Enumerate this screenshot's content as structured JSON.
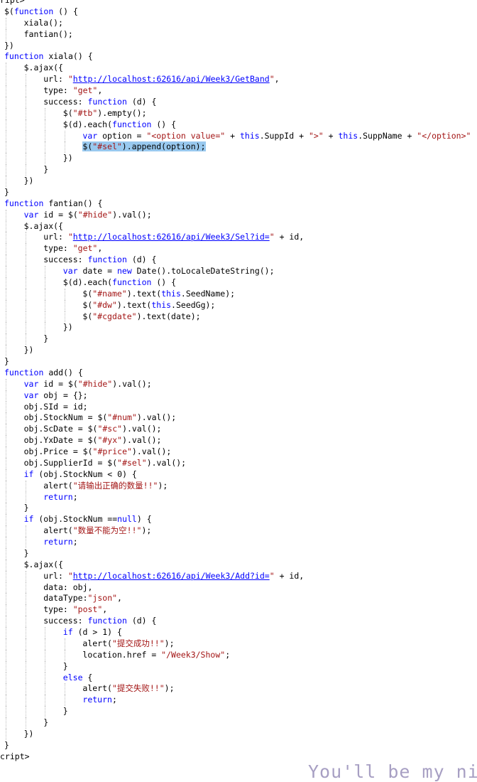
{
  "code": {
    "lines": [
      {
        "indent": 0,
        "tokens": [
          {
            "t": "ript>"
          }
        ]
      },
      {
        "indent": 0,
        "tokens": [
          {
            "t": "$("
          },
          {
            "t": "function",
            "c": "kw"
          },
          {
            "t": " () {"
          }
        ]
      },
      {
        "indent": 1,
        "tokens": [
          {
            "t": "xiala();"
          }
        ]
      },
      {
        "indent": 1,
        "tokens": [
          {
            "t": "fantian();"
          }
        ]
      },
      {
        "indent": 0,
        "tokens": [
          {
            "t": "})"
          }
        ]
      },
      {
        "indent": 0,
        "tokens": [
          {
            "t": "function",
            "c": "kw"
          },
          {
            "t": " xiala() {"
          }
        ]
      },
      {
        "indent": 1,
        "tokens": [
          {
            "t": "$.ajax({"
          }
        ]
      },
      {
        "indent": 2,
        "tokens": [
          {
            "t": "url: "
          },
          {
            "t": "\"",
            "c": "str"
          },
          {
            "t": "http://localhost:62616/api/Week3/GetBand",
            "c": "url"
          },
          {
            "t": "\"",
            "c": "str"
          },
          {
            "t": ","
          }
        ]
      },
      {
        "indent": 2,
        "tokens": [
          {
            "t": "type: "
          },
          {
            "t": "\"get\"",
            "c": "str"
          },
          {
            "t": ","
          }
        ]
      },
      {
        "indent": 2,
        "tokens": [
          {
            "t": "success: "
          },
          {
            "t": "function",
            "c": "kw"
          },
          {
            "t": " (d) {"
          }
        ]
      },
      {
        "indent": 3,
        "tokens": [
          {
            "t": "$("
          },
          {
            "t": "\"#tb\"",
            "c": "str"
          },
          {
            "t": ").empty();"
          }
        ]
      },
      {
        "indent": 3,
        "tokens": [
          {
            "t": "$(d).each("
          },
          {
            "t": "function",
            "c": "kw"
          },
          {
            "t": " () {"
          }
        ]
      },
      {
        "indent": 4,
        "tokens": [
          {
            "t": "var",
            "c": "kw"
          },
          {
            "t": " option = "
          },
          {
            "t": "\"<option value=\"",
            "c": "str"
          },
          {
            "t": " + "
          },
          {
            "t": "this",
            "c": "kw"
          },
          {
            "t": ".SuppId + "
          },
          {
            "t": "\">\"",
            "c": "str"
          },
          {
            "t": " + "
          },
          {
            "t": "this",
            "c": "kw"
          },
          {
            "t": ".SuppName + "
          },
          {
            "t": "\"</option>\"",
            "c": "str"
          }
        ]
      },
      {
        "indent": 4,
        "tokens": [
          {
            "t": "$(",
            "c": "hl"
          },
          {
            "t": "\"#sel\"",
            "c": "hl-str"
          },
          {
            "t": ").append(option);",
            "c": "hl"
          }
        ]
      },
      {
        "indent": 3,
        "tokens": [
          {
            "t": "})"
          }
        ]
      },
      {
        "indent": 2,
        "tokens": [
          {
            "t": "}"
          }
        ]
      },
      {
        "indent": 1,
        "tokens": [
          {
            "t": "})"
          }
        ]
      },
      {
        "indent": 0,
        "tokens": [
          {
            "t": "}"
          }
        ]
      },
      {
        "indent": 0,
        "tokens": [
          {
            "t": "function",
            "c": "kw"
          },
          {
            "t": " fantian() {"
          }
        ]
      },
      {
        "indent": 1,
        "tokens": [
          {
            "t": "var",
            "c": "kw"
          },
          {
            "t": " id = $("
          },
          {
            "t": "\"#hide\"",
            "c": "str"
          },
          {
            "t": ").val();"
          }
        ]
      },
      {
        "indent": 1,
        "tokens": [
          {
            "t": "$.ajax({"
          }
        ]
      },
      {
        "indent": 2,
        "tokens": [
          {
            "t": "url: "
          },
          {
            "t": "\"",
            "c": "str"
          },
          {
            "t": "http://localhost:62616/api/Week3/Sel?id=",
            "c": "url"
          },
          {
            "t": "\"",
            "c": "str"
          },
          {
            "t": " + id,"
          }
        ]
      },
      {
        "indent": 2,
        "tokens": [
          {
            "t": "type: "
          },
          {
            "t": "\"get\"",
            "c": "str"
          },
          {
            "t": ","
          }
        ]
      },
      {
        "indent": 2,
        "tokens": [
          {
            "t": "success: "
          },
          {
            "t": "function",
            "c": "kw"
          },
          {
            "t": " (d) {"
          }
        ]
      },
      {
        "indent": 3,
        "tokens": [
          {
            "t": "var",
            "c": "kw"
          },
          {
            "t": " date = "
          },
          {
            "t": "new",
            "c": "kw"
          },
          {
            "t": " Date().toLocaleDateString();"
          }
        ]
      },
      {
        "indent": 3,
        "tokens": [
          {
            "t": "$(d).each("
          },
          {
            "t": "function",
            "c": "kw"
          },
          {
            "t": " () {"
          }
        ]
      },
      {
        "indent": 4,
        "tokens": [
          {
            "t": "$("
          },
          {
            "t": "\"#name\"",
            "c": "str"
          },
          {
            "t": ").text("
          },
          {
            "t": "this",
            "c": "kw"
          },
          {
            "t": ".SeedName);"
          }
        ]
      },
      {
        "indent": 4,
        "tokens": [
          {
            "t": "$("
          },
          {
            "t": "\"#dw\"",
            "c": "str"
          },
          {
            "t": ").text("
          },
          {
            "t": "this",
            "c": "kw"
          },
          {
            "t": ".SeedGg);"
          }
        ]
      },
      {
        "indent": 4,
        "tokens": [
          {
            "t": "$("
          },
          {
            "t": "\"#cgdate\"",
            "c": "str"
          },
          {
            "t": ").text(date);"
          }
        ]
      },
      {
        "indent": 3,
        "tokens": [
          {
            "t": "})"
          }
        ]
      },
      {
        "indent": 2,
        "tokens": [
          {
            "t": "}"
          }
        ]
      },
      {
        "indent": 1,
        "tokens": [
          {
            "t": "})"
          }
        ]
      },
      {
        "indent": 0,
        "tokens": [
          {
            "t": "}"
          }
        ]
      },
      {
        "indent": 0,
        "tokens": [
          {
            "t": "function",
            "c": "kw"
          },
          {
            "t": " add() {"
          }
        ]
      },
      {
        "indent": 1,
        "tokens": [
          {
            "t": "var",
            "c": "kw"
          },
          {
            "t": " id = $("
          },
          {
            "t": "\"#hide\"",
            "c": "str"
          },
          {
            "t": ").val();"
          }
        ]
      },
      {
        "indent": 1,
        "tokens": [
          {
            "t": "var",
            "c": "kw"
          },
          {
            "t": " obj = {};"
          }
        ]
      },
      {
        "indent": 1,
        "tokens": [
          {
            "t": "obj.SId = id;"
          }
        ]
      },
      {
        "indent": 1,
        "tokens": [
          {
            "t": "obj.StockNum = $("
          },
          {
            "t": "\"#num\"",
            "c": "str"
          },
          {
            "t": ").val();"
          }
        ]
      },
      {
        "indent": 1,
        "tokens": [
          {
            "t": "obj.ScDate = $("
          },
          {
            "t": "\"#sc\"",
            "c": "str"
          },
          {
            "t": ").val();"
          }
        ]
      },
      {
        "indent": 1,
        "tokens": [
          {
            "t": "obj.YxDate = $("
          },
          {
            "t": "\"#yx\"",
            "c": "str"
          },
          {
            "t": ").val();"
          }
        ]
      },
      {
        "indent": 1,
        "tokens": [
          {
            "t": "obj.Price = $("
          },
          {
            "t": "\"#price\"",
            "c": "str"
          },
          {
            "t": ").val();"
          }
        ]
      },
      {
        "indent": 1,
        "tokens": [
          {
            "t": "obj.SupplierId = $("
          },
          {
            "t": "\"#sel\"",
            "c": "str"
          },
          {
            "t": ").val();"
          }
        ]
      },
      {
        "indent": 1,
        "tokens": [
          {
            "t": "if",
            "c": "kw"
          },
          {
            "t": " (obj.StockNum < 0) {"
          }
        ]
      },
      {
        "indent": 2,
        "tokens": [
          {
            "t": "alert("
          },
          {
            "t": "\"请输出正确的数量!!\"",
            "c": "str"
          },
          {
            "t": ");"
          }
        ]
      },
      {
        "indent": 2,
        "tokens": [
          {
            "t": "return",
            "c": "kw"
          },
          {
            "t": ";"
          }
        ]
      },
      {
        "indent": 1,
        "tokens": [
          {
            "t": "}"
          }
        ]
      },
      {
        "indent": 1,
        "tokens": [
          {
            "t": "if",
            "c": "kw"
          },
          {
            "t": " (obj.StockNum =="
          },
          {
            "t": "null",
            "c": "kw"
          },
          {
            "t": ") {"
          }
        ]
      },
      {
        "indent": 2,
        "tokens": [
          {
            "t": "alert("
          },
          {
            "t": "\"数量不能为空!!\"",
            "c": "str"
          },
          {
            "t": ");"
          }
        ]
      },
      {
        "indent": 2,
        "tokens": [
          {
            "t": "return",
            "c": "kw"
          },
          {
            "t": ";"
          }
        ]
      },
      {
        "indent": 1,
        "tokens": [
          {
            "t": "}"
          }
        ]
      },
      {
        "indent": 1,
        "tokens": [
          {
            "t": "$.ajax({"
          }
        ]
      },
      {
        "indent": 2,
        "tokens": [
          {
            "t": "url: "
          },
          {
            "t": "\"",
            "c": "str"
          },
          {
            "t": "http://localhost:62616/api/Week3/Add?id=",
            "c": "url"
          },
          {
            "t": "\"",
            "c": "str"
          },
          {
            "t": " + id,"
          }
        ]
      },
      {
        "indent": 2,
        "tokens": [
          {
            "t": "data: obj,"
          }
        ]
      },
      {
        "indent": 2,
        "tokens": [
          {
            "t": "dataType:"
          },
          {
            "t": "\"json\"",
            "c": "str"
          },
          {
            "t": ","
          }
        ]
      },
      {
        "indent": 2,
        "tokens": [
          {
            "t": "type: "
          },
          {
            "t": "\"post\"",
            "c": "str"
          },
          {
            "t": ","
          }
        ]
      },
      {
        "indent": 2,
        "tokens": [
          {
            "t": "success: "
          },
          {
            "t": "function",
            "c": "kw"
          },
          {
            "t": " (d) {"
          }
        ]
      },
      {
        "indent": 3,
        "tokens": [
          {
            "t": "if",
            "c": "kw"
          },
          {
            "t": " (d > 1) {"
          }
        ]
      },
      {
        "indent": 4,
        "tokens": [
          {
            "t": "alert("
          },
          {
            "t": "\"提交成功!!\"",
            "c": "str"
          },
          {
            "t": ");"
          }
        ]
      },
      {
        "indent": 4,
        "tokens": [
          {
            "t": "location.href = "
          },
          {
            "t": "\"/Week3/Show\"",
            "c": "str"
          },
          {
            "t": ";"
          }
        ]
      },
      {
        "indent": 3,
        "tokens": [
          {
            "t": "}"
          }
        ]
      },
      {
        "indent": 3,
        "tokens": [
          {
            "t": "else",
            "c": "kw"
          },
          {
            "t": " {"
          }
        ]
      },
      {
        "indent": 4,
        "tokens": [
          {
            "t": "alert("
          },
          {
            "t": "\"提交失败!!\"",
            "c": "str"
          },
          {
            "t": ");"
          }
        ]
      },
      {
        "indent": 4,
        "tokens": [
          {
            "t": "return",
            "c": "kw"
          },
          {
            "t": ";"
          }
        ]
      },
      {
        "indent": 3,
        "tokens": [
          {
            "t": "}"
          }
        ]
      },
      {
        "indent": 2,
        "tokens": [
          {
            "t": "}"
          }
        ]
      },
      {
        "indent": 1,
        "tokens": [
          {
            "t": "})"
          }
        ]
      },
      {
        "indent": 0,
        "tokens": [
          {
            "t": "}"
          }
        ]
      },
      {
        "indent": 0,
        "tokens": [
          {
            "t": "cript>"
          }
        ]
      }
    ],
    "highlight_color": "#99c9ef",
    "colors": {
      "keyword": "#0000ff",
      "string": "#a31515",
      "text": "#000000",
      "watermark": "#8a7fb0"
    }
  },
  "watermark": {
    "text": "You'll be my ni"
  }
}
